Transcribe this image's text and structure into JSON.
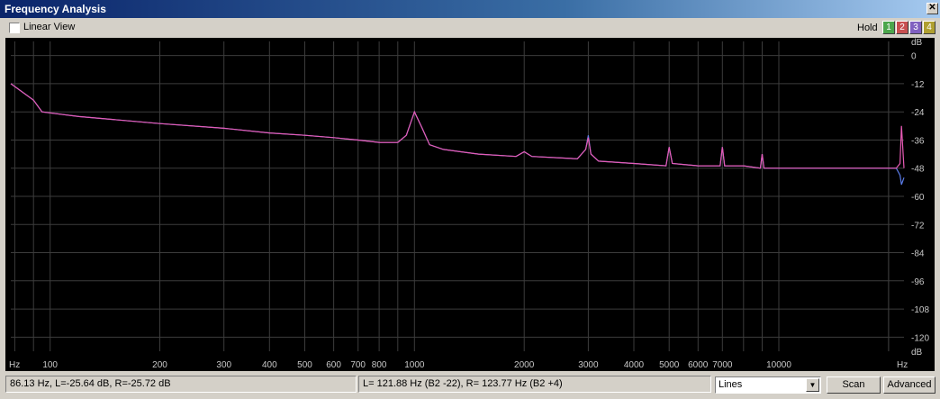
{
  "window": {
    "title": "Frequency Analysis",
    "close_glyph": "✕"
  },
  "toolbar": {
    "linear_view_label": "Linear View",
    "linear_view_checked": false,
    "hold_label": "Hold",
    "hold_buttons": [
      {
        "label": "1",
        "color": "#4ca64c"
      },
      {
        "label": "2",
        "color": "#c85050"
      },
      {
        "label": "3",
        "color": "#8060c0"
      },
      {
        "label": "4",
        "color": "#b0a030"
      }
    ]
  },
  "status": {
    "cursor": "86.13 Hz, L=-25.64 dB, R=-25.72 dB",
    "peak": "L= 121.88 Hz (B2 -22), R= 123.77 Hz (B2 +4)"
  },
  "controls": {
    "graph_mode": "Lines",
    "scan_label": "Scan",
    "advanced_label": "Advanced"
  },
  "colors": {
    "background": "#000000",
    "grid": "#3c3c3c",
    "axis_text": "#c8c8c8",
    "left_channel": "#5a7be6",
    "right_channel": "#e65ab4"
  },
  "chart_data": {
    "type": "line",
    "x_scale": "log",
    "xlim": [
      78,
      22050
    ],
    "ylim": [
      -126,
      6
    ],
    "x_unit": "Hz",
    "y_unit": "dB",
    "x_ticks": [
      {
        "value": 100,
        "label": "100"
      },
      {
        "value": 200,
        "label": "200"
      },
      {
        "value": 300,
        "label": "300"
      },
      {
        "value": 400,
        "label": "400"
      },
      {
        "value": 500,
        "label": "500"
      },
      {
        "value": 600,
        "label": "600"
      },
      {
        "value": 700,
        "label": "700"
      },
      {
        "value": 800,
        "label": "800"
      },
      {
        "value": 1000,
        "label": "1000"
      },
      {
        "value": 2000,
        "label": "2000"
      },
      {
        "value": 3000,
        "label": "3000"
      },
      {
        "value": 4000,
        "label": "4000"
      },
      {
        "value": 5000,
        "label": "5000"
      },
      {
        "value": 6000,
        "label": "6000"
      },
      {
        "value": 7000,
        "label": "7000"
      },
      {
        "value": 10000,
        "label": "10000"
      }
    ],
    "y_ticks": [
      0,
      -12,
      -24,
      -36,
      -48,
      -60,
      -72,
      -84,
      -96,
      -108,
      -120
    ],
    "series": [
      {
        "channel": "L",
        "x": [
          78,
          90,
          95,
          120,
          200,
          300,
          400,
          500,
          600,
          700,
          800,
          900,
          950,
          1000,
          1050,
          1100,
          1200,
          1500,
          1900,
          2000,
          2100,
          2800,
          2950,
          3000,
          3050,
          3200,
          4000,
          4900,
          5000,
          5100,
          6000,
          6900,
          7000,
          7100,
          8000,
          8900,
          9000,
          9100,
          10000,
          11000,
          12000,
          13000,
          15000,
          18000,
          20000,
          21000,
          21500,
          21700,
          22050
        ],
        "y": [
          -12,
          -19,
          -24,
          -26,
          -29,
          -31,
          -33,
          -34,
          -35,
          -36,
          -37,
          -37,
          -34,
          -24,
          -31,
          -38,
          -40,
          -42,
          -43,
          -41,
          -43,
          -44,
          -40,
          -34,
          -42,
          -45,
          -46,
          -47,
          -39,
          -46,
          -47,
          -47,
          -39,
          -47,
          -47,
          -48,
          -42,
          -48,
          -48,
          -48,
          -48,
          -48,
          -48,
          -48,
          -48,
          -48,
          -51,
          -55,
          -52
        ]
      },
      {
        "channel": "R",
        "x": [
          78,
          90,
          95,
          120,
          200,
          300,
          400,
          500,
          600,
          700,
          800,
          900,
          950,
          1000,
          1050,
          1100,
          1200,
          1500,
          1900,
          2000,
          2100,
          2800,
          2950,
          3000,
          3050,
          3200,
          4000,
          4900,
          5000,
          5100,
          6000,
          6900,
          7000,
          7100,
          8000,
          8900,
          9000,
          9100,
          10000,
          11000,
          12000,
          13000,
          15000,
          18000,
          20000,
          21000,
          21500,
          21700,
          22050
        ],
        "y": [
          -12,
          -19,
          -24,
          -26,
          -29,
          -31,
          -33,
          -34,
          -35,
          -36,
          -37,
          -37,
          -34,
          -24,
          -31,
          -38,
          -40,
          -42,
          -43,
          -41,
          -43,
          -44,
          -40,
          -35,
          -42,
          -45,
          -46,
          -47,
          -39,
          -46,
          -47,
          -47,
          -39,
          -47,
          -47,
          -48,
          -42,
          -48,
          -48,
          -48,
          -48,
          -48,
          -48,
          -48,
          -48,
          -48,
          -46,
          -30,
          -48
        ]
      }
    ]
  }
}
